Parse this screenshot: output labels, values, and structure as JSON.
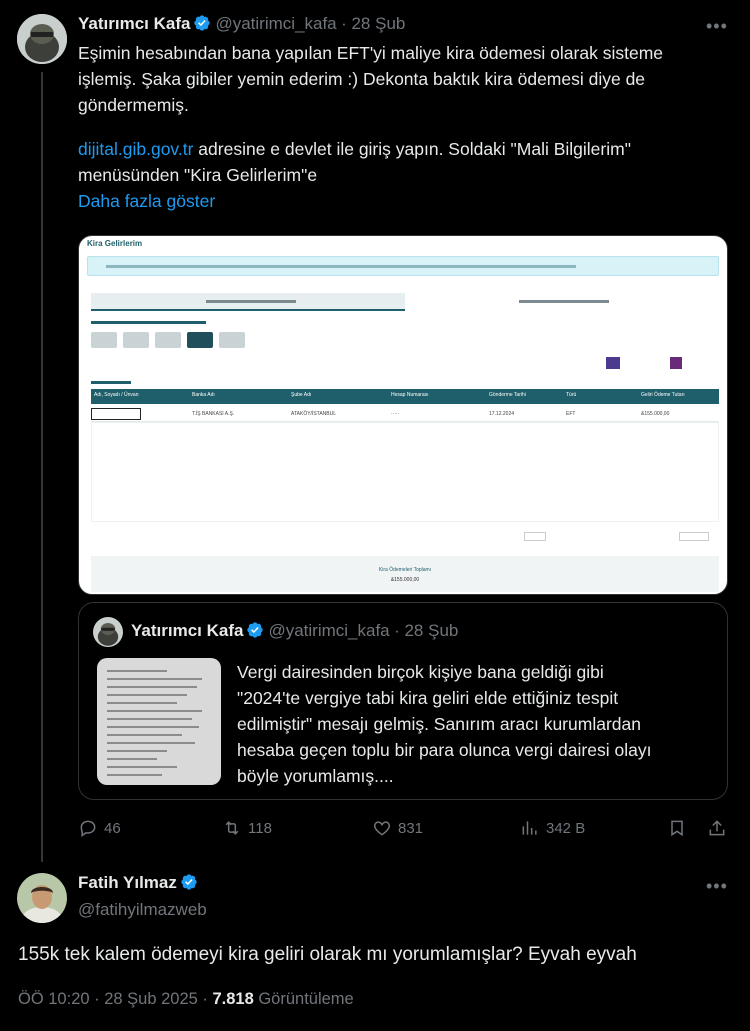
{
  "tweet": {
    "name": "Yatırımcı Kafa",
    "handle": "@yatirimci_kafa",
    "date": "· 28 Şub",
    "lines": [
      "Eşimin hesabından bana yapılan EFT'yi maliye kira ödemesi olarak sisteme",
      "işlemiş. Şaka gibiler yemin ederim :) Dekonta baktık kira ödemesi diye de",
      "göndermemiş."
    ],
    "link_text": "dijital.gib.gov.tr",
    "line2_rest": " adresine e devlet ile giriş yapın. Soldaki \"Mali Bilgilerim\"",
    "line3": "menüsünden \"Kira Gelirlerim\"e",
    "show_more": "Daha fazla göster"
  },
  "media": {
    "title": "Kira Gelirlerim",
    "year_count": 5,
    "table_cols": [
      "Adı, Soyadı / Ünvan",
      "Banka Adı",
      "Şube Adı",
      "Hesap Numarası",
      "Gönderme Tarihi",
      "Türü",
      "Geliri Ödeme Tutarı"
    ],
    "row": [
      "",
      "T.İŞ BANKASI A.Ş.",
      "ATAKÖY/İSTANBUL",
      "·····",
      "17.12.2024",
      "EFT",
      "&155.000,00"
    ],
    "footer_label": "Kira Ödemeleri Toplamı",
    "footer_value": "&155.000,00"
  },
  "quote": {
    "name": "Yatırımcı Kafa",
    "handle": "@yatirimci_kafa",
    "date": "· 28 Şub",
    "lines": [
      "Vergi dairesinden birçok kişiye bana geldiği gibi",
      "\"2024'te vergiye tabi kira geliri elde ettiğiniz tespit",
      "edilmiştir\" mesajı gelmiş. Sanırım aracı kurumlardan",
      "hesaba geçen toplu bir para olunca vergi dairesi olayı",
      "böyle yorumlamış...."
    ]
  },
  "actions": {
    "replies": "46",
    "retweets": "118",
    "likes": "831",
    "views": "342 B"
  },
  "reply": {
    "name": "Fatih Yılmaz",
    "handle": "@fatihyilmazweb",
    "text": "155k tek kalem ödemeyi kira geliri olarak mı yorumlamışlar? Eyvah eyvah",
    "time": "ÖÖ 10:20 · 28 Şub 2025 · ",
    "views_count": "7.818",
    "views_label": " Görüntüleme"
  },
  "colors": {
    "background": "#000000",
    "link": "#1d9bf0",
    "muted": "#71767b",
    "verified": "#1d9bf0"
  }
}
